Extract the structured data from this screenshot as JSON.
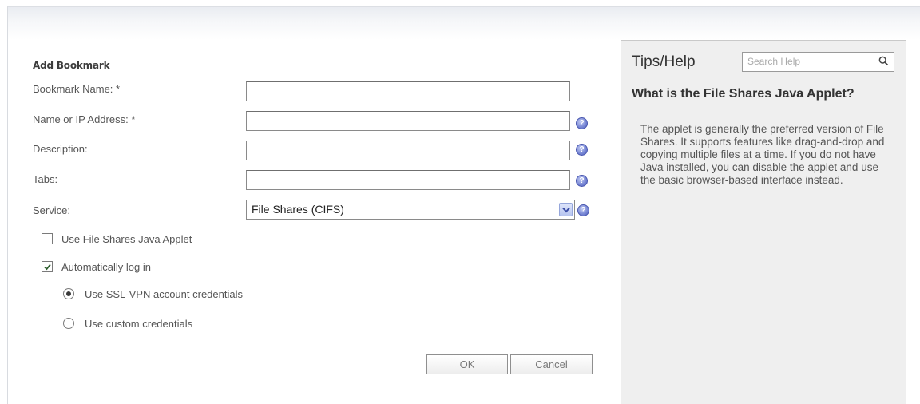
{
  "form": {
    "title": "Add Bookmark",
    "fields": {
      "bookmark_name": {
        "label": "Bookmark Name: *",
        "value": ""
      },
      "name_or_ip": {
        "label": "Name or IP Address: *",
        "value": ""
      },
      "description": {
        "label": "Description:",
        "value": ""
      },
      "tabs": {
        "label": "Tabs:",
        "value": ""
      },
      "service": {
        "label": "Service:",
        "value": "File Shares (CIFS)"
      }
    },
    "options": {
      "use_java_applet": {
        "label": "Use File Shares Java Applet",
        "checked": false
      },
      "auto_login": {
        "label": "Automatically log in",
        "checked": true
      },
      "ssl_vpn_credentials": {
        "label": "Use SSL-VPN account credentials",
        "selected": true
      },
      "custom_credentials": {
        "label": "Use custom credentials",
        "selected": false
      }
    },
    "buttons": {
      "ok": "OK",
      "cancel": "Cancel"
    }
  },
  "help": {
    "title": "Tips/Help",
    "search_placeholder": "Search Help",
    "heading": "What is the File Shares Java Applet?",
    "body": "The applet is generally the preferred version of File Shares. It supports features like drag-and-drop and copying multiple files at a time. If you do not have Java installed, you can disable the applet and use the basic browser-based interface instead."
  },
  "icons": {
    "help": "help-circle-icon",
    "dropdown": "chevron-down-icon",
    "search": "magnifier-icon",
    "check": "checkmark-icon"
  },
  "colors": {
    "help_icon": "#6f7fd0",
    "panel_bg": "#efefef"
  }
}
